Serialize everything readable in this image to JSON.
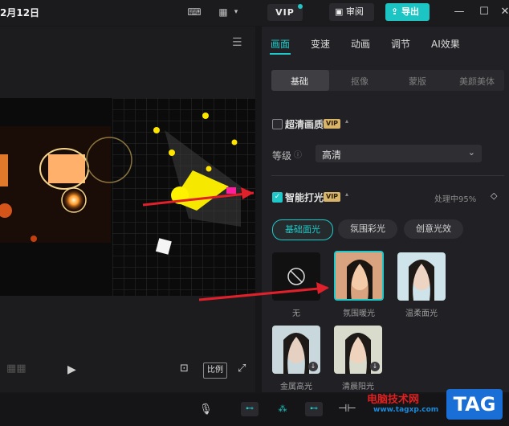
{
  "window": {
    "title": "2月12日",
    "vip_label": "VIP",
    "review_label": "审阅",
    "export_label": "导出"
  },
  "player": {
    "ratio_label": "比例"
  },
  "panel": {
    "tabs": [
      "画面",
      "变速",
      "动画",
      "调节",
      "AI效果"
    ],
    "subtabs": [
      "基础",
      "抠像",
      "蒙版",
      "美颜美体"
    ],
    "super_quality": {
      "label": "超清画质",
      "vip": "VIP"
    },
    "grade": {
      "label": "等级",
      "value": "高清"
    },
    "smart_light": {
      "label": "智能打光",
      "vip": "VIP",
      "status": "处理中95%"
    },
    "light_modes": [
      "基础面光",
      "氛围彩光",
      "创意光效"
    ],
    "presets": [
      {
        "label": "无"
      },
      {
        "label": "氛围暖光"
      },
      {
        "label": "温柔面光"
      },
      {
        "label": "金属高光"
      },
      {
        "label": "清晨阳光"
      }
    ]
  },
  "watermark": {
    "site": "电脑技术网",
    "url": "www.tagxp.com",
    "logo": "TAG"
  },
  "colors": {
    "accent": "#1fc9c9",
    "arrow": "#e0202a",
    "background": "#17171a",
    "panel": "#212125"
  },
  "icons": [
    "keyboard-icon",
    "layout-icon",
    "monitor-icon",
    "share-icon",
    "minimize-icon",
    "maximize-icon",
    "close-icon",
    "menu-icon",
    "play-icon",
    "fullscreen-icon",
    "crop-icon",
    "microphone-icon",
    "diamond-icon"
  ]
}
